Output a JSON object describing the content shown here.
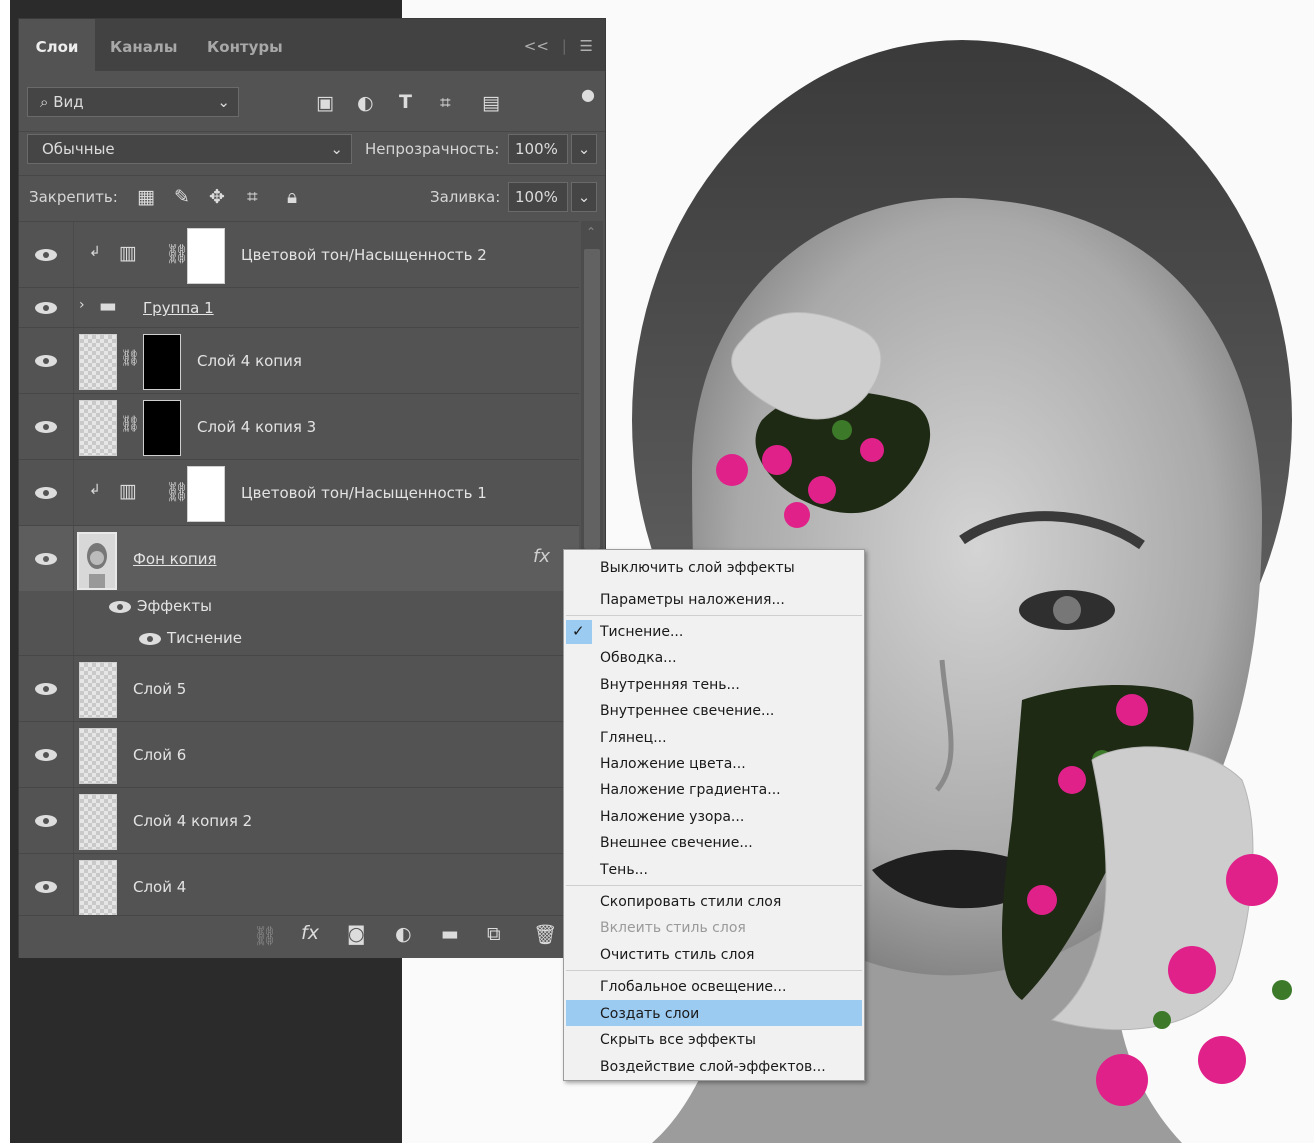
{
  "tabs": {
    "layers": "Слои",
    "channels": "Каналы",
    "paths": "Контуры",
    "collapse": "<<",
    "menu": "☰"
  },
  "filter": {
    "kind": "Вид"
  },
  "blend": {
    "mode": "Обычные",
    "opacity_label": "Непрозрачность:",
    "opacity_value": "100%"
  },
  "lock": {
    "label": "Закрепить:",
    "fill_label": "Заливка:",
    "fill_value": "100%"
  },
  "layers": [
    {
      "name": "Цветовой тон/Насыщенность 2"
    },
    {
      "name": "Группа 1"
    },
    {
      "name": "Слой 4 копия"
    },
    {
      "name": "Слой 4 копия 3"
    },
    {
      "name": "Цветовой тон/Насыщенность 1"
    },
    {
      "name": "Фон копия",
      "fx": "fx"
    },
    {
      "name": "Эффекты"
    },
    {
      "name": "Тиснение"
    },
    {
      "name": "Слой 5"
    },
    {
      "name": "Слой 6"
    },
    {
      "name": "Слой 4 копия 2"
    },
    {
      "name": "Слой 4"
    }
  ],
  "bottom": {
    "fx": "fx"
  },
  "context_menu": [
    {
      "label": "Выключить слой эффекты"
    },
    {
      "label": "Параметры наложения..."
    },
    {
      "label": "Тиснение...",
      "checked": true
    },
    {
      "label": "Обводка..."
    },
    {
      "label": "Внутренняя тень..."
    },
    {
      "label": "Внутреннее свечение..."
    },
    {
      "label": "Глянец..."
    },
    {
      "label": "Наложение цвета..."
    },
    {
      "label": "Наложение градиента..."
    },
    {
      "label": "Наложение узора..."
    },
    {
      "label": "Внешнее свечение..."
    },
    {
      "label": "Тень..."
    },
    {
      "label": "Скопировать стили слоя"
    },
    {
      "label": "Вклеить стиль слоя",
      "disabled": true
    },
    {
      "label": "Очистить стиль слоя"
    },
    {
      "label": "Глобальное освещение..."
    },
    {
      "label": "Создать слои",
      "highlighted": true
    },
    {
      "label": "Скрыть все эффекты"
    },
    {
      "label": "Воздействие слой-эффектов..."
    }
  ],
  "colors": {
    "panel": "#535353",
    "tab_bar": "#424242",
    "menu_bg": "#f1f1f1",
    "menu_highlight": "#9ccbf2",
    "flower": "#e0218a",
    "leaf": "#3c7a2a"
  }
}
